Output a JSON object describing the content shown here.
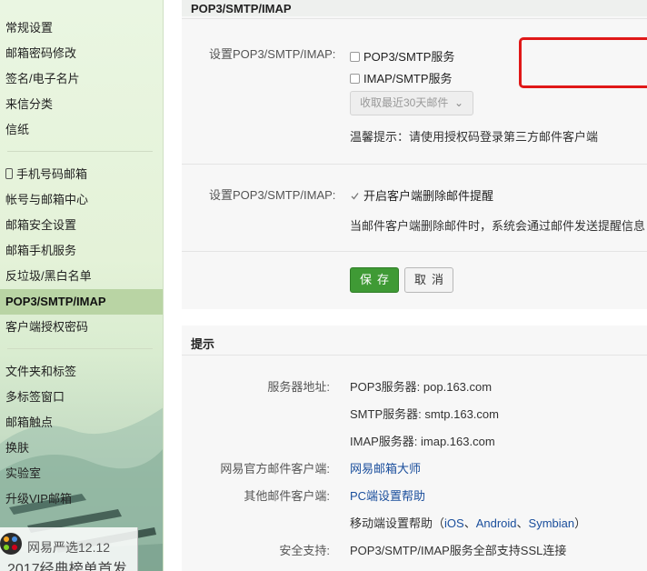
{
  "sidebar": {
    "items": [
      {
        "label": "常规设置"
      },
      {
        "label": "邮箱密码修改"
      },
      {
        "label": "签名/电子名片"
      },
      {
        "label": "来信分类"
      },
      {
        "label": "信纸"
      },
      {
        "label": "手机号码邮箱",
        "icon": "phone-icon"
      },
      {
        "label": "帐号与邮箱中心"
      },
      {
        "label": "邮箱安全设置"
      },
      {
        "label": "邮箱手机服务"
      },
      {
        "label": "反垃圾/黑白名单"
      },
      {
        "label": "POP3/SMTP/IMAP",
        "active": true
      },
      {
        "label": "客户端授权密码"
      },
      {
        "label": "文件夹和标签"
      },
      {
        "label": "多标签窗口"
      },
      {
        "label": "邮箱触点"
      },
      {
        "label": "换肤"
      },
      {
        "label": "实验室"
      },
      {
        "label": "升级VIP邮箱"
      }
    ],
    "promo": {
      "line1": "网易严选12.12",
      "line2": "2017经典榜单首发"
    }
  },
  "settings": {
    "title": "POP3/SMTP/IMAP",
    "row1_label": "设置POP3/SMTP/IMAP:",
    "pop3_option": "POP3/SMTP服务",
    "pop3_checked": false,
    "imap_option": "IMAP/SMTP服务",
    "imap_checked": false,
    "recent_select": "收取最近30天邮件",
    "hint": "温馨提示：请使用授权码登录第三方邮件客户端",
    "row2_label": "设置POP3/SMTP/IMAP:",
    "delete_alert_option": "开启客户端删除邮件提醒",
    "delete_alert_checked": true,
    "delete_alert_desc": "当邮件客户端删除邮件时，系统会通过邮件发送提醒信息",
    "save_label": "保存",
    "cancel_label": "取消"
  },
  "tips": {
    "title": "提示",
    "server_label": "服务器地址:",
    "pop3_server": "POP3服务器: pop.163.com",
    "smtp_server": "SMTP服务器: smtp.163.com",
    "imap_server": "IMAP服务器: imap.163.com",
    "official_client_label": "网易官方邮件客户端:",
    "official_client_link": "网易邮箱大师",
    "other_client_label": "其他邮件客户端:",
    "other_client_link": "PC端设置帮助",
    "mobile_help_prefix": "移动端设置帮助（",
    "mobile_ios": "iOS",
    "sep1": "、",
    "mobile_android": "Android",
    "sep2": "、",
    "mobile_symbian": "Symbian",
    "mobile_help_suffix": "）",
    "security_label": "安全支持:",
    "security_value": "POP3/SMTP/IMAP服务全部支持SSL连接"
  },
  "colors": {
    "save_button": "#3f9a35",
    "highlight_box": "#e01818",
    "link": "#1a4e9c",
    "active_nav": "#b9d4a4"
  }
}
